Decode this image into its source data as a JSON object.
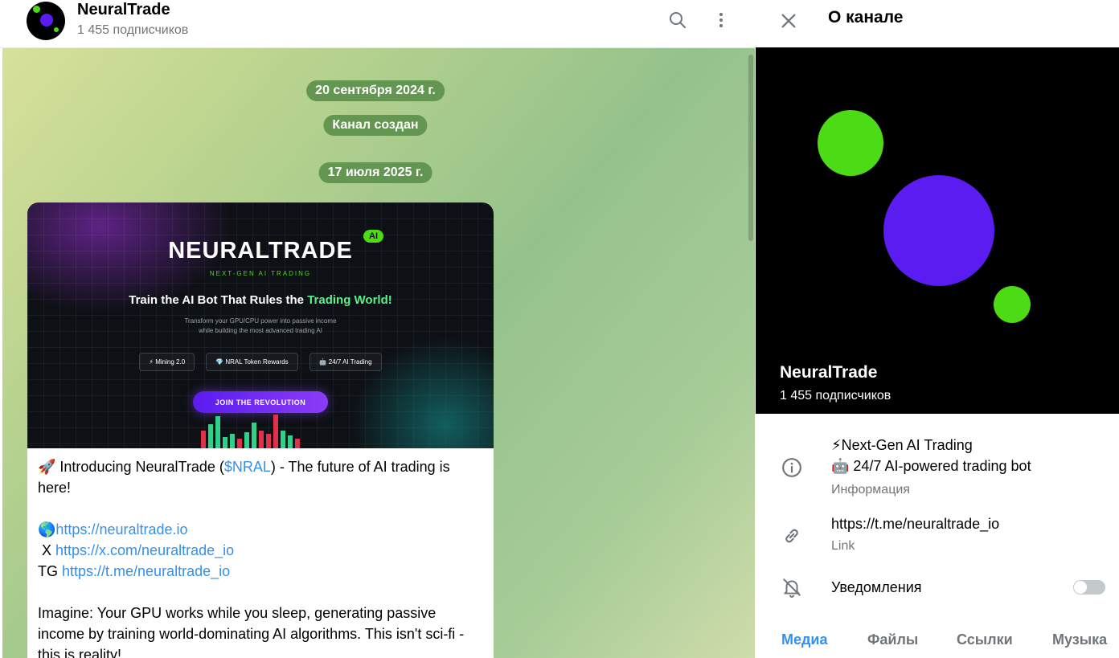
{
  "chat": {
    "title": "NeuralTrade",
    "subscribers": "1 455 подписчиков",
    "icons": {
      "search": "search-icon",
      "more": "more-vertical-icon"
    },
    "service_pills": {
      "date1": "20 сентября 2024 г.",
      "created": "Канал создан",
      "date2": "17 июля 2025 г."
    },
    "banner": {
      "logo": "NEURALTRADE",
      "badge": "AI",
      "tagline": "NEXT-GEN AI TRADING",
      "headline_a": "Train the AI Bot That Rules the ",
      "headline_b": "Trading World!",
      "desc_line1": "Transform your GPU/CPU power into passive income",
      "desc_line2": "while building the most advanced trading AI",
      "chip1": "⚡ Mining 2.0",
      "chip2": "💎 NRAL Token Rewards",
      "chip3": "🤖 24/7 AI Trading",
      "button": "JOIN THE REVOLUTION",
      "colors": {
        "green": "#4ddb15",
        "purple": "#5a1cf0",
        "red": "#e0304a",
        "teal": "#2fd18a"
      }
    },
    "message": {
      "line1_pre": "🚀 Introducing NeuralTrade (",
      "line1_link": "$NRAL",
      "line1_post": ") - The future of AI trading is here!",
      "web_prefix": "🌎",
      "web_link": "https://neuraltrade.io",
      "x_prefix": " X ",
      "x_link": "https://x.com/neuraltrade_io",
      "tg_prefix": "TG ",
      "tg_link": "https://t.me/neuraltrade_io",
      "para2": "Imagine: Your GPU works while you sleep, generating passive income by training world-dominating AI algorithms. This isn't sci-fi - this is reality!"
    }
  },
  "panel": {
    "title": "О канале",
    "close_icon": "close-icon",
    "cover_name": "NeuralTrade",
    "cover_sub": "1 455 подписчиков",
    "cover_colors": {
      "bg": "#000000",
      "green": "#4ddb15",
      "purple": "#5a1cf0"
    },
    "info": {
      "line1": "⚡Next-Gen AI Trading",
      "line2": "🤖 24/7 AI-powered trading bot",
      "label": "Информация",
      "icon": "info-icon"
    },
    "link": {
      "value": "https://t.me/neuraltrade_io",
      "label": "Link",
      "icon": "link-icon"
    },
    "notifications": {
      "label": "Уведомления",
      "icon": "bell-off-icon",
      "enabled": false
    },
    "tabs": [
      {
        "label": "Медиа",
        "active": true
      },
      {
        "label": "Файлы",
        "active": false
      },
      {
        "label": "Ссылки",
        "active": false
      },
      {
        "label": "Музыка",
        "active": false
      }
    ]
  }
}
